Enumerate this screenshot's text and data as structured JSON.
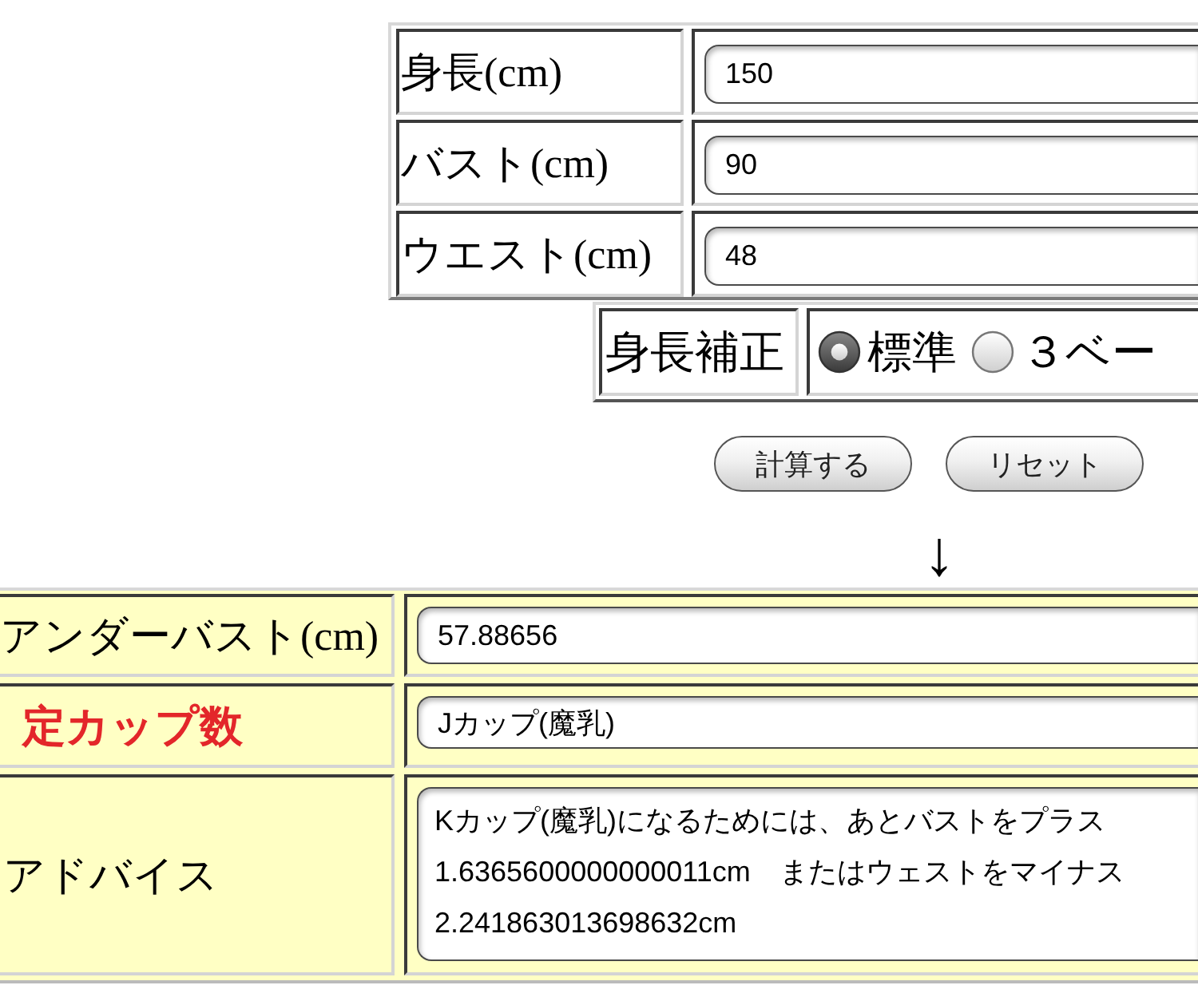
{
  "measurements": [
    {
      "label": "身長(cm)",
      "value": "150"
    },
    {
      "label": "バスト(cm)",
      "value": "90"
    },
    {
      "label": "ウエスト(cm)",
      "value": "48"
    }
  ],
  "height_correction": {
    "label": "身長補正",
    "options": [
      {
        "label": "標準",
        "selected": true
      },
      {
        "label": "３ベー",
        "selected": false
      }
    ]
  },
  "buttons": [
    "計算する",
    "リセット"
  ],
  "arrow": "↓",
  "results": [
    {
      "label": "アンダーバスト(cm)",
      "highlighted": false,
      "kind": "field",
      "value": "57.88656"
    },
    {
      "label": "定カップ数",
      "highlighted": true,
      "kind": "field",
      "value": "Jカップ(魔乳)"
    },
    {
      "label": "アドバイス",
      "highlighted": false,
      "kind": "textarea",
      "lines": [
        "Kカップ(魔乳)になるためには、あとバストをプラス",
        "1.6365600000000011cm　またはウェストをマイナス",
        "2.241863013698632cm"
      ]
    }
  ]
}
